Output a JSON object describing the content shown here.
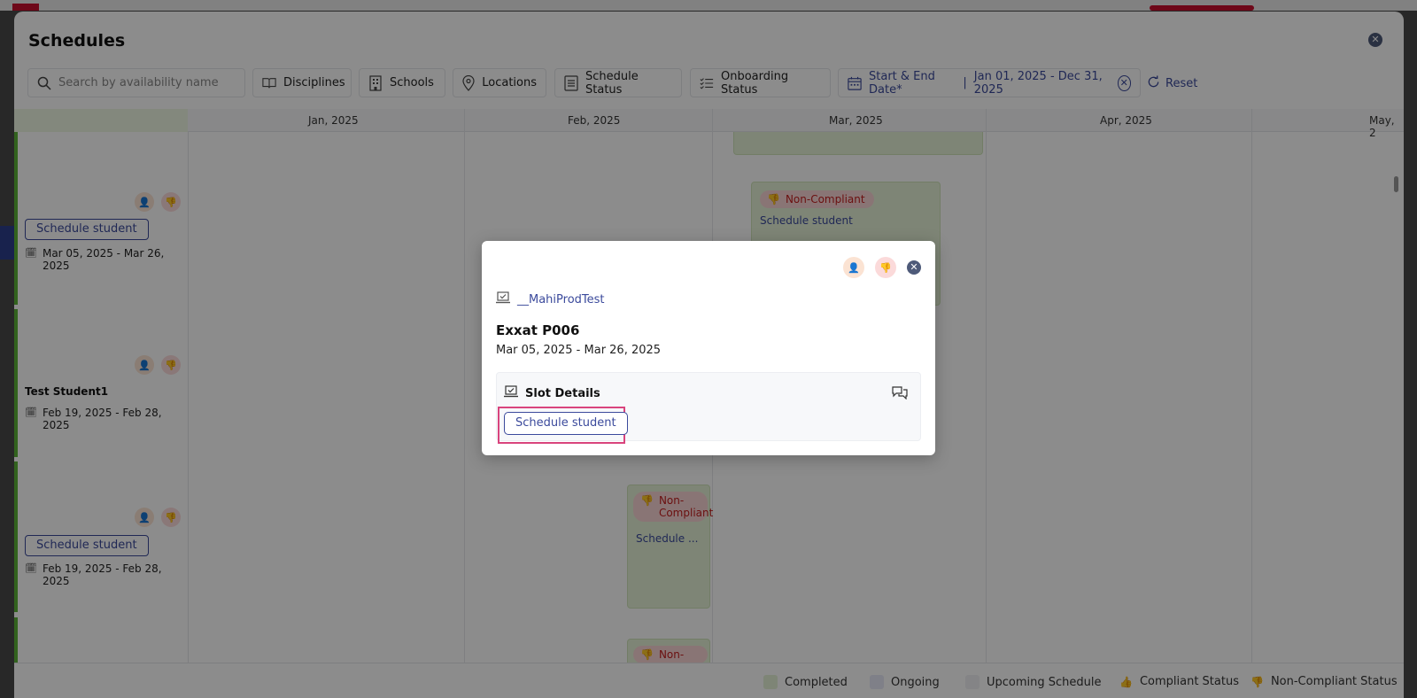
{
  "modal": {
    "title": "Schedules"
  },
  "filters": {
    "search_placeholder": "Search by availability name",
    "disciplines": "Disciplines",
    "schools": "Schools",
    "locations": "Locations",
    "schedule_status": "Schedule Status",
    "onboarding_status": "Onboarding Status",
    "date_label": "Start & End Date*",
    "date_separator": "|",
    "date_value": "Jan 01, 2025 - Dec 31, 2025",
    "reset": "Reset"
  },
  "timeline": {
    "months": [
      "Jan, 2025",
      "Feb, 2025",
      "Mar, 2025",
      "Apr, 2025",
      "May, 2"
    ]
  },
  "lanes": [
    {
      "button": "Schedule student",
      "date": "Mar 05, 2025 - Mar 26, 2025"
    },
    {
      "name": "Test Student1",
      "date": "Feb 19, 2025 - Feb 28, 2025"
    },
    {
      "button": "Schedule student",
      "date": "Feb 19, 2025 - Feb 28, 2025"
    }
  ],
  "bars": [
    {
      "tag": "Non-Compliant",
      "link": "Schedule student"
    },
    {
      "tag_line1": "Non-",
      "tag_line2": "Compliant",
      "link": "Schedule ..."
    },
    {
      "tag_line1": "Non-"
    }
  ],
  "legend": {
    "completed": "Completed",
    "ongoing": "Ongoing",
    "upcoming": "Upcoming Schedule",
    "compliant": "Compliant Status",
    "noncompliant": "Non-Compliant Status",
    "colors": {
      "completed": "#e6f3d8",
      "ongoing": "#e8eaf8",
      "upcoming": "#f0f1f4"
    }
  },
  "popup": {
    "program": "__MahiProdTest",
    "title": "Exxat P006",
    "date": "Mar 05, 2025 - Mar 26, 2025",
    "slot_header": "Slot Details",
    "schedule_button": "Schedule student"
  }
}
